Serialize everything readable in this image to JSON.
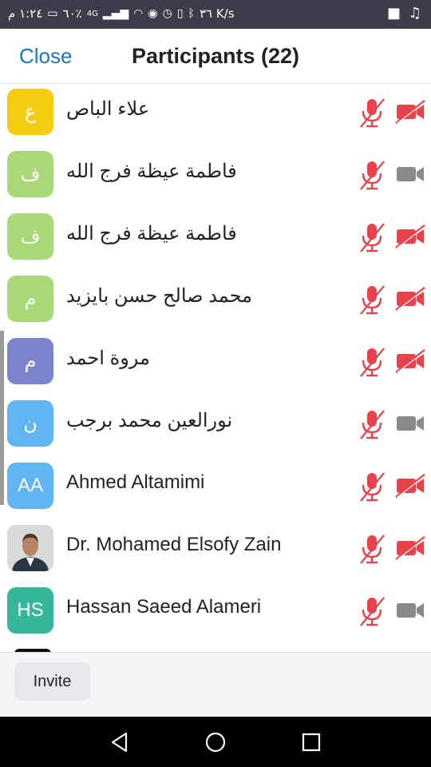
{
  "status_bar": {
    "time": "١:٢٤ م",
    "battery": "٦٠٪",
    "signal": "4G",
    "net_speed": "٣٦ K/s"
  },
  "header": {
    "close_label": "Close",
    "title": "Participants (22)"
  },
  "participants": [
    {
      "name": "علاء الباص",
      "initial": "ع",
      "avatar_color": "#f5cc12",
      "mic_muted": true,
      "video_off": true
    },
    {
      "name": "فاطمة عيظة فرج الله",
      "initial": "ف",
      "avatar_color": "#a8d878",
      "mic_muted": true,
      "video_off": false
    },
    {
      "name": "فاطمة عيظة فرج الله",
      "initial": "ف",
      "avatar_color": "#a8d878",
      "mic_muted": true,
      "video_off": true
    },
    {
      "name": "محمد صالح حسن بايزيد",
      "initial": "م",
      "avatar_color": "#a8d878",
      "mic_muted": true,
      "video_off": true
    },
    {
      "name": "مروة احمد",
      "initial": "م",
      "avatar_color": "#7b83cc",
      "mic_muted": true,
      "video_off": true
    },
    {
      "name": "نورالعين محمد برجب",
      "initial": "ن",
      "avatar_color": "#5fb6f2",
      "mic_muted": true,
      "video_off": false
    },
    {
      "name": "Ahmed Altamimi",
      "initial": "AA",
      "avatar_color": "#5fb6f2",
      "mic_muted": true,
      "video_off": true
    },
    {
      "name": "Dr. Mohamed Elsofy Zain",
      "initial": "",
      "avatar_color": "#c9c9c9",
      "photo": true,
      "mic_muted": true,
      "video_off": true
    },
    {
      "name": "Hassan Saeed Alameri",
      "initial": "HS",
      "avatar_color": "#35b79a",
      "mic_muted": true,
      "video_off": false
    }
  ],
  "footer": {
    "invite_label": "Invite"
  },
  "colors": {
    "accent": "#1a73c8",
    "muted_red": "#e8424a",
    "cam_gray": "#8a8a8a"
  }
}
